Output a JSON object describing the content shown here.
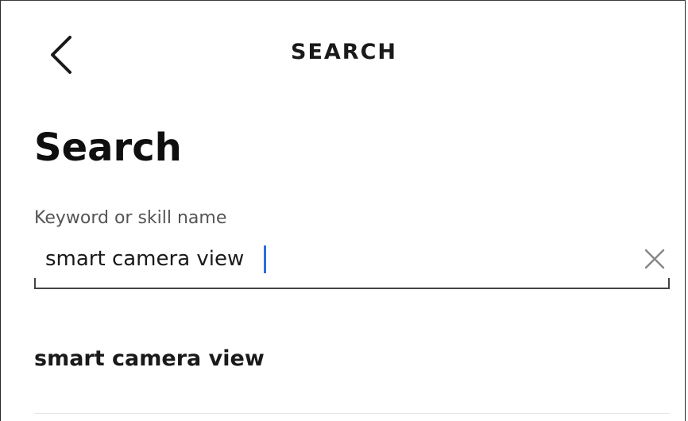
{
  "header": {
    "title": "SEARCH",
    "back_icon": "chevron-left-icon"
  },
  "page": {
    "title": "Search"
  },
  "search": {
    "label": "Keyword or skill name",
    "value": "smart camera view",
    "clear_icon": "close-icon",
    "caret_color": "#2b6de0"
  },
  "suggestions": [
    {
      "label": "smart camera view"
    }
  ]
}
